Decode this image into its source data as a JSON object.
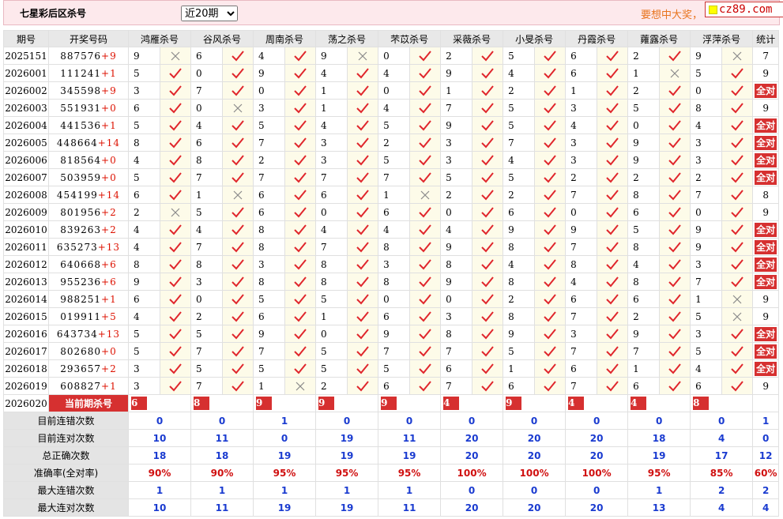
{
  "header": {
    "title": "七星彩后区杀号",
    "period_select": {
      "selected": "近20期",
      "options": [
        "近20期"
      ]
    },
    "slogan": "要想中大奖，",
    "logo_text": "cz89.com"
  },
  "columns": {
    "period": "期号",
    "draw": "开奖号码",
    "experts": [
      "鸿雁杀号",
      "谷风杀号",
      "周南杀号",
      "荡之杀号",
      "芣苡杀号",
      "采薇杀号",
      "小旻杀号",
      "丹霞杀号",
      "蕹露杀号",
      "浮萍杀号"
    ],
    "stat": "统计"
  },
  "all_correct_label": "全对",
  "rows": [
    {
      "period": "2025151",
      "main": "887576",
      "extra": "+9",
      "k": [
        9,
        6,
        4,
        9,
        0,
        2,
        5,
        6,
        2,
        9
      ],
      "ok": [
        0,
        1,
        1,
        0,
        1,
        1,
        1,
        1,
        1,
        0
      ],
      "stat": "7"
    },
    {
      "period": "2026001",
      "main": "111241",
      "extra": "+1",
      "k": [
        5,
        0,
        9,
        4,
        4,
        9,
        4,
        6,
        1,
        5
      ],
      "ok": [
        1,
        1,
        1,
        1,
        1,
        1,
        1,
        1,
        0,
        1
      ],
      "stat": "9"
    },
    {
      "period": "2026002",
      "main": "345598",
      "extra": "+9",
      "k": [
        3,
        7,
        0,
        1,
        0,
        1,
        2,
        1,
        2,
        0
      ],
      "ok": [
        1,
        1,
        1,
        1,
        1,
        1,
        1,
        1,
        1,
        1
      ],
      "stat": "全对"
    },
    {
      "period": "2026003",
      "main": "551931",
      "extra": "+0",
      "k": [
        6,
        0,
        3,
        1,
        4,
        7,
        5,
        3,
        5,
        8
      ],
      "ok": [
        1,
        0,
        1,
        1,
        1,
        1,
        1,
        1,
        1,
        1
      ],
      "stat": "9"
    },
    {
      "period": "2026004",
      "main": "441536",
      "extra": "+1",
      "k": [
        5,
        4,
        5,
        4,
        5,
        9,
        5,
        4,
        0,
        4
      ],
      "ok": [
        1,
        1,
        1,
        1,
        1,
        1,
        1,
        1,
        1,
        1
      ],
      "stat": "全对"
    },
    {
      "period": "2026005",
      "main": "448664",
      "extra": "+14",
      "k": [
        8,
        6,
        7,
        3,
        2,
        3,
        7,
        3,
        9,
        3
      ],
      "ok": [
        1,
        1,
        1,
        1,
        1,
        1,
        1,
        1,
        1,
        1
      ],
      "stat": "全对"
    },
    {
      "period": "2026006",
      "main": "818564",
      "extra": "+0",
      "k": [
        4,
        8,
        2,
        3,
        5,
        3,
        4,
        3,
        9,
        3
      ],
      "ok": [
        1,
        1,
        1,
        1,
        1,
        1,
        1,
        1,
        1,
        1
      ],
      "stat": "全对"
    },
    {
      "period": "2026007",
      "main": "503959",
      "extra": "+0",
      "k": [
        5,
        7,
        7,
        7,
        7,
        5,
        5,
        2,
        2,
        2
      ],
      "ok": [
        1,
        1,
        1,
        1,
        1,
        1,
        1,
        1,
        1,
        1
      ],
      "stat": "全对"
    },
    {
      "period": "2026008",
      "main": "454199",
      "extra": "+14",
      "k": [
        6,
        1,
        6,
        6,
        1,
        2,
        2,
        7,
        8,
        7
      ],
      "ok": [
        1,
        0,
        1,
        1,
        0,
        1,
        1,
        1,
        1,
        1
      ],
      "stat": "8"
    },
    {
      "period": "2026009",
      "main": "801956",
      "extra": "+2",
      "k": [
        2,
        5,
        6,
        0,
        6,
        0,
        6,
        0,
        6,
        0
      ],
      "ok": [
        0,
        1,
        1,
        1,
        1,
        1,
        1,
        1,
        1,
        1
      ],
      "stat": "9"
    },
    {
      "period": "2026010",
      "main": "839263",
      "extra": "+2",
      "k": [
        4,
        4,
        8,
        4,
        4,
        4,
        9,
        9,
        5,
        9
      ],
      "ok": [
        1,
        1,
        1,
        1,
        1,
        1,
        1,
        1,
        1,
        1
      ],
      "stat": "全对"
    },
    {
      "period": "2026011",
      "main": "635273",
      "extra": "+13",
      "k": [
        4,
        7,
        8,
        7,
        8,
        9,
        8,
        7,
        8,
        9
      ],
      "ok": [
        1,
        1,
        1,
        1,
        1,
        1,
        1,
        1,
        1,
        1
      ],
      "stat": "全对"
    },
    {
      "period": "2026012",
      "main": "640668",
      "extra": "+6",
      "k": [
        8,
        8,
        3,
        8,
        3,
        8,
        4,
        8,
        4,
        3
      ],
      "ok": [
        1,
        1,
        1,
        1,
        1,
        1,
        1,
        1,
        1,
        1
      ],
      "stat": "全对"
    },
    {
      "period": "2026013",
      "main": "955236",
      "extra": "+6",
      "k": [
        9,
        3,
        8,
        8,
        8,
        9,
        8,
        4,
        8,
        7
      ],
      "ok": [
        1,
        1,
        1,
        1,
        1,
        1,
        1,
        1,
        1,
        1
      ],
      "stat": "全对"
    },
    {
      "period": "2026014",
      "main": "988251",
      "extra": "+1",
      "k": [
        6,
        0,
        5,
        5,
        0,
        0,
        2,
        6,
        6,
        1
      ],
      "ok": [
        1,
        1,
        1,
        1,
        1,
        1,
        1,
        1,
        1,
        0
      ],
      "stat": "9"
    },
    {
      "period": "2026015",
      "main": "019911",
      "extra": "+5",
      "k": [
        4,
        2,
        6,
        1,
        6,
        3,
        8,
        7,
        2,
        5
      ],
      "ok": [
        1,
        1,
        1,
        1,
        1,
        1,
        1,
        1,
        1,
        0
      ],
      "stat": "9"
    },
    {
      "period": "2026016",
      "main": "643734",
      "extra": "+13",
      "k": [
        5,
        5,
        9,
        0,
        9,
        8,
        9,
        3,
        9,
        3
      ],
      "ok": [
        1,
        1,
        1,
        1,
        1,
        1,
        1,
        1,
        1,
        1
      ],
      "stat": "全对"
    },
    {
      "period": "2026017",
      "main": "802680",
      "extra": "+0",
      "k": [
        5,
        7,
        7,
        5,
        7,
        7,
        5,
        7,
        7,
        5
      ],
      "ok": [
        1,
        1,
        1,
        1,
        1,
        1,
        1,
        1,
        1,
        1
      ],
      "stat": "全对"
    },
    {
      "period": "2026018",
      "main": "293657",
      "extra": "+2",
      "k": [
        3,
        5,
        5,
        5,
        5,
        6,
        1,
        6,
        1,
        4
      ],
      "ok": [
        1,
        1,
        1,
        1,
        1,
        1,
        1,
        1,
        1,
        1
      ],
      "stat": "全对"
    },
    {
      "period": "2026019",
      "main": "608827",
      "extra": "+1",
      "k": [
        3,
        7,
        1,
        2,
        6,
        7,
        6,
        7,
        6,
        6
      ],
      "ok": [
        1,
        1,
        0,
        1,
        1,
        1,
        1,
        1,
        1,
        1
      ],
      "stat": "9"
    }
  ],
  "current": {
    "period": "2026020",
    "label": "当前期杀号",
    "k": [
      6,
      8,
      9,
      9,
      9,
      4,
      9,
      4,
      4,
      8
    ]
  },
  "stats": [
    {
      "label": "目前连错次数",
      "values": [
        "0",
        "0",
        "1",
        "0",
        "0",
        "0",
        "0",
        "0",
        "0",
        "0"
      ],
      "stat": "1",
      "rate": false
    },
    {
      "label": "目前连对次数",
      "values": [
        "10",
        "11",
        "0",
        "19",
        "11",
        "20",
        "20",
        "20",
        "18",
        "4"
      ],
      "stat": "0",
      "rate": false
    },
    {
      "label": "总正确次数",
      "values": [
        "18",
        "18",
        "19",
        "19",
        "19",
        "20",
        "20",
        "20",
        "19",
        "17"
      ],
      "stat": "12",
      "rate": false
    },
    {
      "label": "准确率(全对率)",
      "values": [
        "90%",
        "90%",
        "95%",
        "95%",
        "95%",
        "100%",
        "100%",
        "100%",
        "95%",
        "85%"
      ],
      "stat": "60%",
      "rate": true
    },
    {
      "label": "最大连错次数",
      "values": [
        "1",
        "1",
        "1",
        "1",
        "1",
        "0",
        "0",
        "0",
        "1",
        "2"
      ],
      "stat": "2",
      "rate": false
    },
    {
      "label": "最大连对次数",
      "values": [
        "10",
        "11",
        "19",
        "19",
        "11",
        "20",
        "20",
        "20",
        "13",
        "4"
      ],
      "stat": "4",
      "rate": false
    }
  ],
  "colors": {
    "check": "#e0262c",
    "cross": "#8a8a8a",
    "accent_red": "#d63030",
    "stat_blue": "#1a3bd0"
  }
}
